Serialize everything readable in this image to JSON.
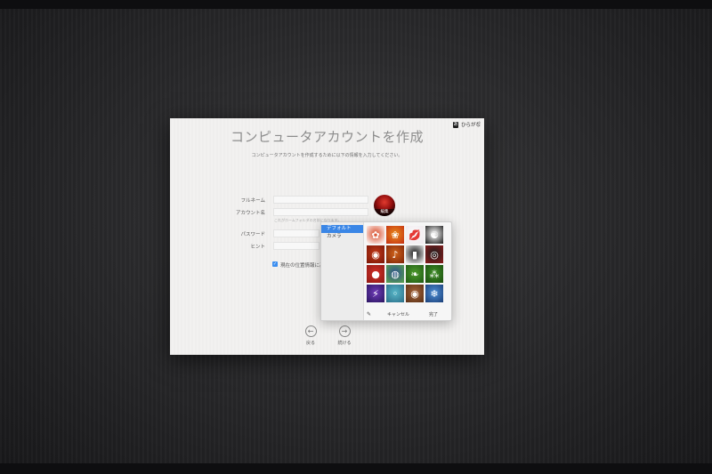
{
  "dialog": {
    "title": "コンピュータアカウントを作成",
    "subtitle": "コンピュータアカウントを作成するために以下の情報を入力してください。",
    "ime": {
      "icon": "あ",
      "label": "ひらがな"
    },
    "form": {
      "fullname_label": "フルネーム",
      "account_label": "アカウント名",
      "account_hint": "これがホームフォルダの名前になります。",
      "password_label": "パスワード",
      "hint_label": "ヒント",
      "location_checkbox_label": "現在の位置情報に基",
      "location_checked": true
    },
    "avatar": {
      "edit_label": "編集"
    },
    "nav": {
      "back_label": "戻る",
      "continue_label": "続ける"
    }
  },
  "picker": {
    "sidebar": [
      {
        "label": "デフォルト",
        "selected": true
      },
      {
        "label": "カメラ",
        "selected": false
      }
    ],
    "images": [
      {
        "name": "ladybug-picture",
        "glyph": "✿",
        "color": "#d84c2a",
        "color2": "#ffffff"
      },
      {
        "name": "flower-picture",
        "glyph": "❀",
        "color": "#e88a1a",
        "color2": "#c42f13"
      },
      {
        "name": "lips-picture",
        "glyph": "💋",
        "color": "#fbfbfb",
        "color2": "#f0e9ee"
      },
      {
        "name": "yin-yang-picture",
        "glyph": "☯",
        "color": "#ffffff",
        "color2": "#1a1a1a"
      },
      {
        "name": "drum-picture",
        "glyph": "◉",
        "color": "#c23a1a",
        "color2": "#7a1606"
      },
      {
        "name": "guitar-picture",
        "glyph": "♪",
        "color": "#d0631a",
        "color2": "#7d2308"
      },
      {
        "name": "piano-picture",
        "glyph": "▮",
        "color": "#1a1a1a",
        "color2": "#f5f5f5"
      },
      {
        "name": "vinyl-picture",
        "glyph": "◎",
        "color": "#1f1f1f",
        "color2": "#8b1a1a"
      },
      {
        "name": "ball-picture",
        "glyph": "●",
        "color": "#d23028",
        "color2": "#8e1914"
      },
      {
        "name": "earth-picture",
        "glyph": "◍",
        "color": "#2b4f8f",
        "color2": "#5aa34a"
      },
      {
        "name": "leaf-picture",
        "glyph": "❧",
        "color": "#4d9a2b",
        "color2": "#1f5a14"
      },
      {
        "name": "grass-picture",
        "glyph": "⁂",
        "color": "#3f8f26",
        "color2": "#1a4d10"
      },
      {
        "name": "lightning-picture",
        "glyph": "⚡",
        "color": "#6f3bb8",
        "color2": "#2a1560"
      },
      {
        "name": "eggs-picture",
        "glyph": "◦",
        "color": "#58b7c8",
        "color2": "#2c6f8a"
      },
      {
        "name": "shell-picture",
        "glyph": "◉",
        "color": "#a6643a",
        "color2": "#5a3015"
      },
      {
        "name": "snowflake-picture",
        "glyph": "❄",
        "color": "#4d8fd6",
        "color2": "#1b3f78"
      }
    ],
    "footer": {
      "edit_icon": "pencil-icon",
      "cancel_label": "キャンセル",
      "done_label": "完了"
    }
  }
}
